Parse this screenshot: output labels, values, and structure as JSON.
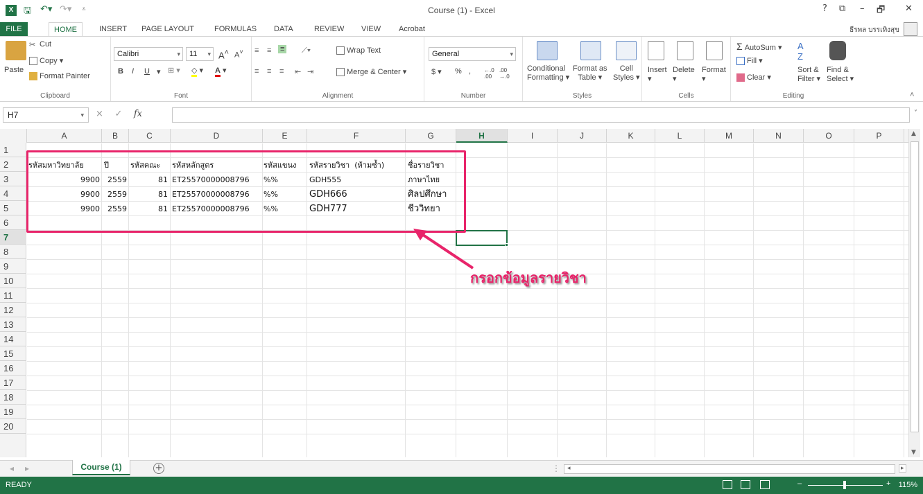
{
  "window": {
    "title": "Course (1) - Excel",
    "app_logo": "X"
  },
  "quick_access": {
    "save_icon": "save-icon",
    "undo_icon": "undo-icon",
    "redo_icon": "redo-icon"
  },
  "window_buttons": {
    "help": "?",
    "restore_ribbon": "⧉",
    "minimize": "–",
    "maximize": "🗗",
    "close": "✕"
  },
  "tabs": [
    "FILE",
    "HOME",
    "INSERT",
    "PAGE LAYOUT",
    "FORMULAS",
    "DATA",
    "REVIEW",
    "VIEW",
    "Acrobat"
  ],
  "user": {
    "name": "ธีรพล บรรเทิงสุข"
  },
  "ribbon": {
    "clipboard": {
      "paste": "Paste",
      "cut": "Cut",
      "copy": "Copy",
      "format_painter": "Format Painter",
      "label": "Clipboard"
    },
    "font": {
      "name": "Calibri",
      "size": "11",
      "bold": "B",
      "italic": "I",
      "underline": "U",
      "label": "Font"
    },
    "alignment": {
      "wrap_text": "Wrap Text",
      "merge_center": "Merge & Center",
      "label": "Alignment"
    },
    "number": {
      "format": "General",
      "currency": "$",
      "percent": "%",
      "comma": ",",
      "label": "Number"
    },
    "styles": {
      "conditional": "Conditional",
      "conditional2": "Formatting",
      "format_as": "Format as",
      "format_as2": "Table",
      "cell": "Cell",
      "cell2": "Styles",
      "label": "Styles"
    },
    "cells": {
      "insert": "Insert",
      "delete": "Delete",
      "format": "Format",
      "label": "Cells"
    },
    "editing": {
      "autosum": "AutoSum",
      "fill": "Fill",
      "clear": "Clear",
      "sort": "Sort &",
      "sort2": "Filter",
      "find": "Find &",
      "find2": "Select",
      "label": "Editing"
    }
  },
  "formula_bar": {
    "name_box": "H7",
    "fx": "fx",
    "cancel": "×",
    "enter": "✓",
    "value": ""
  },
  "columns": [
    "A",
    "B",
    "C",
    "D",
    "E",
    "F",
    "G",
    "H",
    "I",
    "J",
    "K",
    "L",
    "M",
    "N",
    "O",
    "P"
  ],
  "active_column": "H",
  "rows": [
    "1",
    "2",
    "3",
    "4",
    "5",
    "6",
    "7",
    "8",
    "9",
    "10",
    "11",
    "12",
    "13",
    "14",
    "15",
    "16",
    "17",
    "18",
    "19",
    "20"
  ],
  "active_row": "7",
  "sheet": {
    "headers": {
      "a": "รหัสมหาวิทยาลัย",
      "b": "ปี",
      "c": "รหัสคณะ",
      "d": "รหัสหลักสูตร",
      "e": "รหัสแขนง",
      "f": "รหัสรายวิชา",
      "f_note": "(ห้ามซ้ำ)",
      "g": "ชื่อรายวิชา"
    },
    "data_rows": [
      {
        "a": "9900",
        "b": "2559",
        "c": "81",
        "d": "ET25570000008796",
        "e": "%%",
        "f": "GDH555",
        "g": "ภาษาไทย"
      },
      {
        "a": "9900",
        "b": "2559",
        "c": "81",
        "d": "ET25570000008796",
        "e": "%%",
        "f": "GDH666",
        "g": "ศิลปศึกษา"
      },
      {
        "a": "9900",
        "b": "2559",
        "c": "81",
        "d": "ET25570000008796",
        "e": "%%",
        "f": "GDH777",
        "g": "ชีววิทยา"
      }
    ]
  },
  "annotation": {
    "text": "กรอกข้อมูลรายวิชา",
    "color": "#e8246a"
  },
  "sheet_tabs": {
    "active": "Course (1)",
    "add": "+"
  },
  "status": {
    "text": "READY",
    "zoom": "115%",
    "zoom_fraction": 0.5
  },
  "colors": {
    "excel_green": "#217346"
  }
}
